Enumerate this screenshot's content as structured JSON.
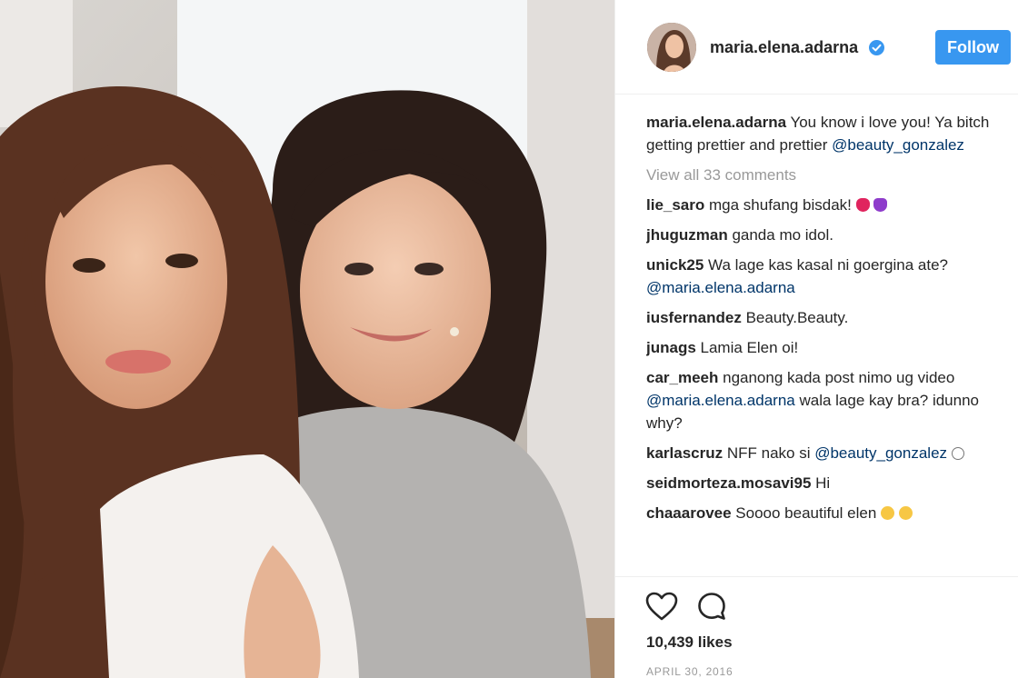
{
  "post": {
    "username": "maria.elena.adarna",
    "follow_label": "Follow",
    "caption_user": "maria.elena.adarna",
    "caption_text_1": " You know i love you! Ya bitch getting prettier and prettier ",
    "caption_mention": "@beauty_gonzalez",
    "view_all": "View all 33 comments",
    "likes": "10,439 likes",
    "date": "APRIL 30, 2016"
  },
  "comments": [
    {
      "user": "lie_saro",
      "text": " mga shufang bisdak! "
    },
    {
      "user": "jhuguzman",
      "text": " ganda mo idol."
    },
    {
      "user": "unick25",
      "text": " Wa lage kas kasal ni goergina ate? ",
      "mention": "@maria.elena.adarna"
    },
    {
      "user": "iusfernandez",
      "text": " Beauty.Beauty."
    },
    {
      "user": "junags",
      "text": " Lamia Elen oi!"
    },
    {
      "user": "car_meeh",
      "text": " nganong kada post nimo ug video ",
      "mention": "@maria.elena.adarna",
      "text2": " wala lage kay bra? idunno why?"
    },
    {
      "user": "karlascruz",
      "text": " NFF nako si ",
      "mention": "@beauty_gonzalez"
    },
    {
      "user": "seidmorteza.mosavi95",
      "text": " Hi"
    },
    {
      "user": "chaaarovee",
      "text": " Soooo beautiful elen "
    }
  ],
  "colors": {
    "follow_button": "#3897f0",
    "mention": "#003569",
    "verified": "#3897f0"
  },
  "icons": [
    "verified-badge-icon",
    "heart-icon",
    "comment-icon"
  ]
}
